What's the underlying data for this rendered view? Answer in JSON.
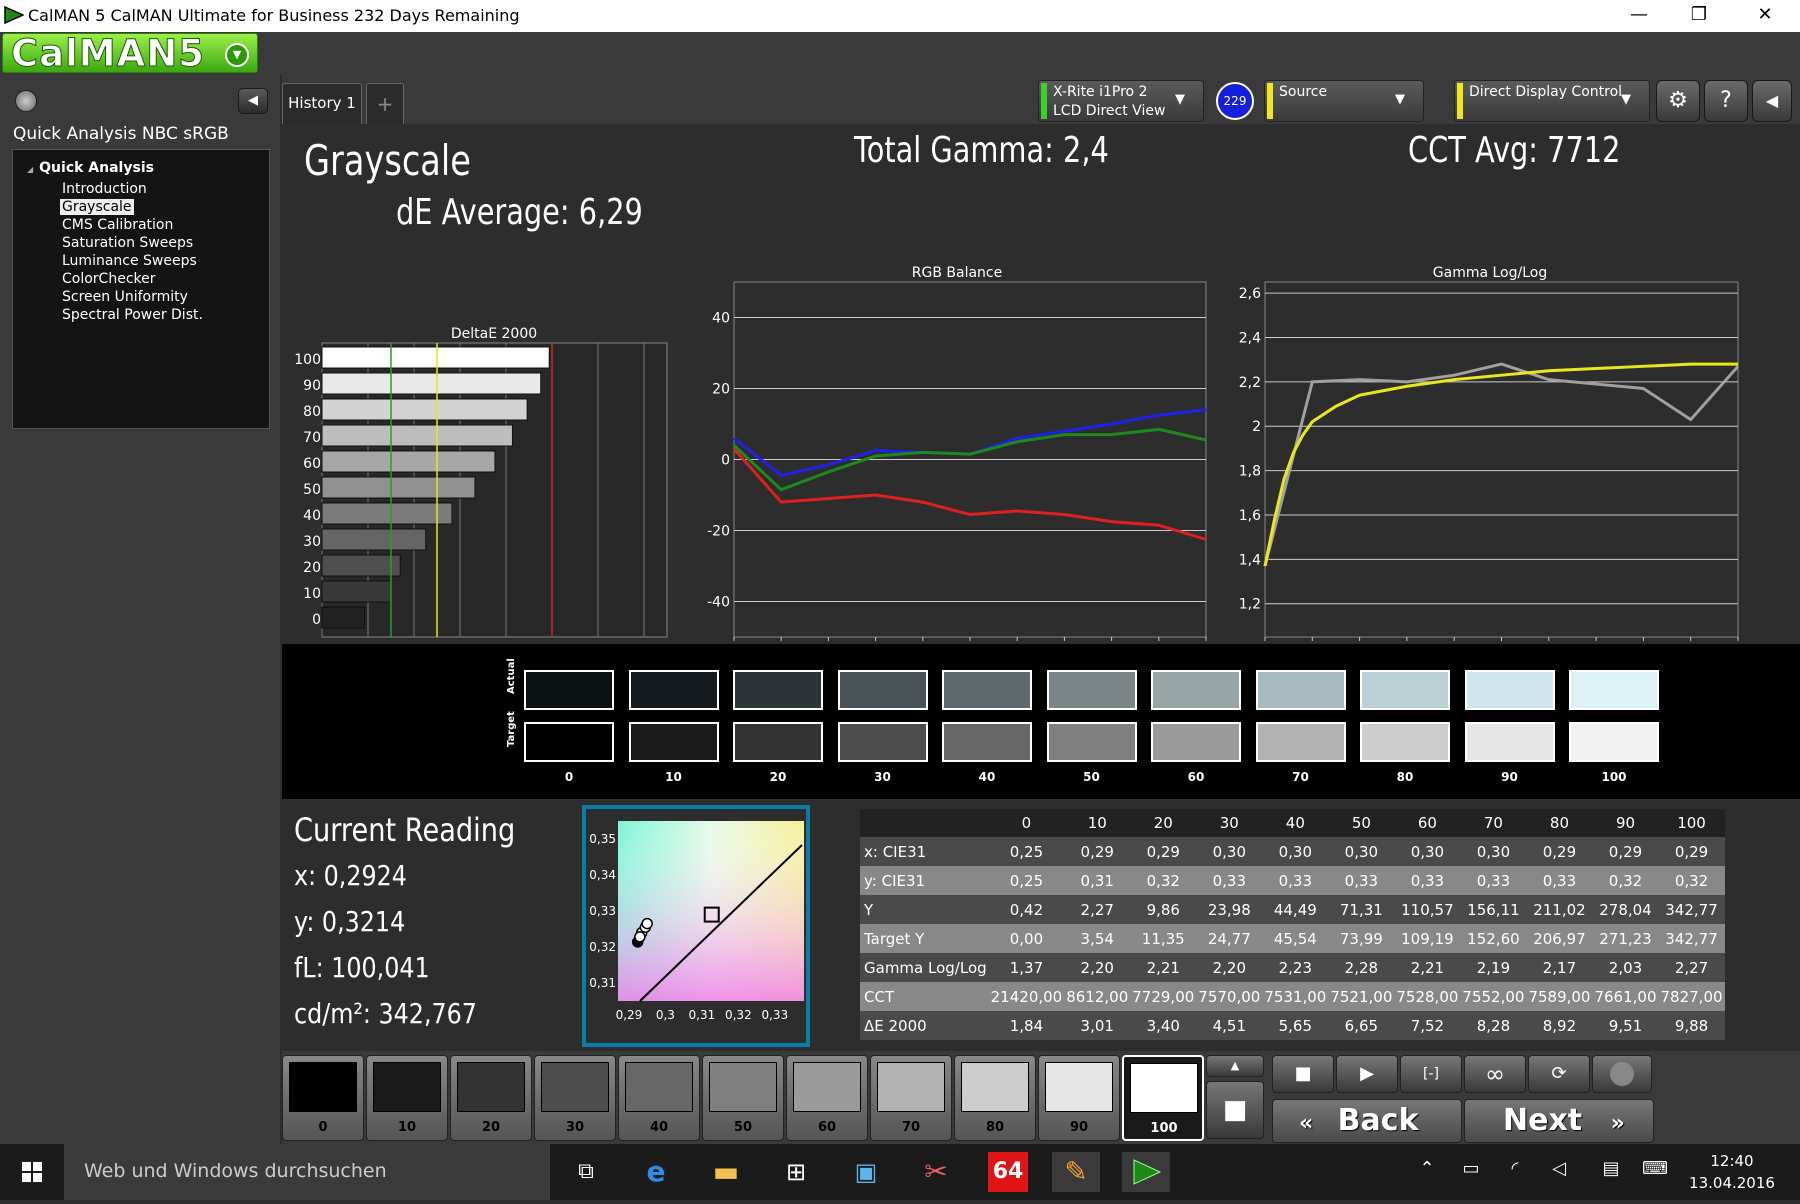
{
  "window": {
    "title": "CalMAN 5 CalMAN Ultimate for Business 232 Days Remaining",
    "min": "—",
    "restore": "❐",
    "close": "✕"
  },
  "logo": {
    "text": "CalMAN5",
    "dropdown": "▼"
  },
  "sidebar": {
    "collapse": "◀",
    "workflow_title": "Quick Analysis NBC sRGB",
    "group_label": "Quick Analysis",
    "items": [
      {
        "label": "Introduction"
      },
      {
        "label": "Grayscale"
      },
      {
        "label": "CMS Calibration"
      },
      {
        "label": "Saturation Sweeps"
      },
      {
        "label": "Luminance Sweeps"
      },
      {
        "label": "ColorChecker"
      },
      {
        "label": "Screen Uniformity"
      },
      {
        "label": "Spectral Power Dist."
      }
    ],
    "selected_index": 1
  },
  "tabs": {
    "history": "History 1",
    "add": "+"
  },
  "devices": {
    "meter": {
      "line1": "X-Rite i1Pro 2",
      "line2": "LCD Direct View",
      "color": "#39d12a"
    },
    "meter_badge": "229",
    "source": {
      "line1": "Source",
      "color": "#f0e61e"
    },
    "display": {
      "line1": "Direct Display Control",
      "color": "#f0e61e"
    },
    "dropdown": "▼",
    "settings": "⚙",
    "help": "?",
    "collapse": "◀"
  },
  "page": {
    "title": "Grayscale",
    "de_average": "dE Average: 6,29",
    "total_gamma": "Total Gamma: 2,4",
    "cct_avg": "CCT Avg: 7712"
  },
  "chart_data": [
    {
      "type": "bar",
      "title": "DeltaE 2000",
      "orientation": "horizontal",
      "categories": [
        "100",
        "90",
        "80",
        "70",
        "60",
        "50",
        "40",
        "30",
        "20",
        "10",
        "0"
      ],
      "values": [
        9.88,
        9.51,
        8.92,
        8.28,
        7.52,
        6.65,
        5.65,
        4.51,
        3.4,
        3.01,
        1.84
      ],
      "xlim": [
        0,
        15
      ],
      "xticks": [
        "0",
        "2",
        "4",
        "6",
        "8",
        "10",
        "12",
        "14"
      ],
      "thresholds": [
        {
          "value": 3,
          "color": "#2a9d2a"
        },
        {
          "value": 5,
          "color": "#e6e61e"
        },
        {
          "value": 10,
          "color": "#d42020"
        }
      ]
    },
    {
      "type": "line",
      "title": "RGB Balance",
      "x": [
        0,
        10,
        20,
        30,
        40,
        50,
        60,
        70,
        80,
        90,
        100
      ],
      "xticks": [
        "0",
        "10",
        "20",
        "30",
        "40",
        "50",
        "60",
        "70",
        "80",
        "90",
        "100"
      ],
      "ylim": [
        -50,
        50
      ],
      "yticks": [
        "40",
        "20",
        "0",
        "-20",
        "-40"
      ],
      "series": [
        {
          "color": "#e02020",
          "values": [
            3,
            -12,
            -11,
            -10,
            -12,
            -15.5,
            -14.5,
            -15.5,
            -17.5,
            -18.5,
            -22.5
          ]
        },
        {
          "color": "#2020e8",
          "values": [
            6,
            -4.5,
            -1.5,
            2.5,
            2,
            1.5,
            6,
            8,
            10,
            12.5,
            14
          ]
        },
        {
          "color": "#1e8a1e",
          "values": [
            4,
            -8.5,
            -3.5,
            1,
            2,
            1.5,
            5,
            7,
            7,
            8.5,
            5.5
          ]
        }
      ]
    },
    {
      "type": "line",
      "title": "Gamma Log/Log",
      "x": [
        0,
        10,
        20,
        30,
        40,
        50,
        60,
        70,
        80,
        90,
        100
      ],
      "xticks": [
        "0",
        "10",
        "20",
        "30",
        "40",
        "50",
        "60",
        "70",
        "80",
        "90",
        "100"
      ],
      "ylim": [
        1.05,
        2.65
      ],
      "yticks": [
        "2,6",
        "2,4",
        "2,2",
        "2",
        "1,8",
        "1,6",
        "1,4",
        "1,2"
      ],
      "series": [
        {
          "color": "#a0a0a0",
          "values": [
            1.37,
            2.2,
            2.21,
            2.2,
            2.23,
            2.28,
            2.21,
            2.19,
            2.17,
            2.03,
            2.27
          ]
        },
        {
          "color": "#e8e81e",
          "curve": [
            [
              0,
              1.37
            ],
            [
              2,
              1.58
            ],
            [
              4,
              1.76
            ],
            [
              6,
              1.88
            ],
            [
              8,
              1.96
            ],
            [
              10,
              2.02
            ],
            [
              15,
              2.09
            ],
            [
              20,
              2.14
            ],
            [
              30,
              2.18
            ],
            [
              40,
              2.21
            ],
            [
              50,
              2.23
            ],
            [
              60,
              2.25
            ],
            [
              70,
              2.26
            ],
            [
              80,
              2.27
            ],
            [
              90,
              2.28
            ],
            [
              100,
              2.28
            ]
          ]
        }
      ]
    },
    {
      "type": "scatter",
      "title": "CIE xy",
      "xticks": [
        "0,29",
        "0,3",
        "0,31",
        "0,32",
        "0,33"
      ],
      "yticks": [
        "0,35",
        "0,34",
        "0,33",
        "0,32",
        "0,31"
      ],
      "xlim": [
        0.287,
        0.338
      ],
      "ylim": [
        0.305,
        0.355
      ],
      "target": {
        "x": 0.3127,
        "y": 0.329
      },
      "points": [
        [
          0.2924,
          0.3214
        ],
        [
          0.2935,
          0.324
        ],
        [
          0.2945,
          0.3255
        ],
        [
          0.295,
          0.3265
        ],
        [
          0.293,
          0.3228
        ]
      ]
    }
  ],
  "swatches": {
    "actual_label": "Actual",
    "target_label": "Target",
    "levels": [
      "0",
      "10",
      "20",
      "30",
      "40",
      "50",
      "60",
      "70",
      "80",
      "90",
      "100"
    ],
    "actual_colors": [
      "#0c1114",
      "#141a1d",
      "#2c3437",
      "#4a5357",
      "#5f686c",
      "#7b8588",
      "#98a5a7",
      "#aabbbf",
      "#bcd1d5",
      "#d0e6ec",
      "#dcf2f7"
    ],
    "target_colors": [
      "#000000",
      "#1a1a1a",
      "#333333",
      "#4d4d4d",
      "#676767",
      "#808080",
      "#9a9a9a",
      "#b3b3b3",
      "#cdcdcd",
      "#e6e6e6",
      "#f2f2f2"
    ]
  },
  "current_reading": {
    "title": "Current Reading",
    "x": "x: 0,2924",
    "y": "y: 0,3214",
    "fl": "fL: 100,041",
    "cdm2": "cd/m²: 342,767"
  },
  "table": {
    "columns": [
      "",
      "0",
      "10",
      "20",
      "30",
      "40",
      "50",
      "60",
      "70",
      "80",
      "90",
      "100"
    ],
    "rows": [
      {
        "label": "x: CIE31",
        "values": [
          "0,25",
          "0,29",
          "0,29",
          "0,30",
          "0,30",
          "0,30",
          "0,30",
          "0,30",
          "0,29",
          "0,29",
          "0,29"
        ]
      },
      {
        "label": "y: CIE31",
        "values": [
          "0,25",
          "0,31",
          "0,32",
          "0,33",
          "0,33",
          "0,33",
          "0,33",
          "0,33",
          "0,33",
          "0,32",
          "0,32"
        ]
      },
      {
        "label": "Y",
        "values": [
          "0,42",
          "2,27",
          "9,86",
          "23,98",
          "44,49",
          "71,31",
          "110,57",
          "156,11",
          "211,02",
          "278,04",
          "342,77"
        ]
      },
      {
        "label": "Target Y",
        "values": [
          "0,00",
          "3,54",
          "11,35",
          "24,77",
          "45,54",
          "73,99",
          "109,19",
          "152,60",
          "206,97",
          "271,23",
          "342,77"
        ]
      },
      {
        "label": "Gamma Log/Log",
        "values": [
          "1,37",
          "2,20",
          "2,21",
          "2,20",
          "2,23",
          "2,28",
          "2,21",
          "2,19",
          "2,17",
          "2,03",
          "2,27"
        ]
      },
      {
        "label": "CCT",
        "values": [
          "21420,00",
          "8612,00",
          "7729,00",
          "7570,00",
          "7531,00",
          "7521,00",
          "7528,00",
          "7552,00",
          "7589,00",
          "7661,00",
          "7827,00"
        ]
      },
      {
        "label": "ΔE 2000",
        "values": [
          "1,84",
          "3,01",
          "3,40",
          "4,51",
          "5,65",
          "6,65",
          "7,52",
          "8,28",
          "8,92",
          "9,51",
          "9,88"
        ]
      }
    ]
  },
  "patches": {
    "labels": [
      "0",
      "10",
      "20",
      "30",
      "40",
      "50",
      "60",
      "70",
      "80",
      "90",
      "100"
    ],
    "colors": [
      "#000000",
      "#1a1a1a",
      "#333333",
      "#4d4d4d",
      "#676767",
      "#808080",
      "#9a9a9a",
      "#b3b3b3",
      "#cdcdcd",
      "#e6e6e6",
      "#ffffff"
    ],
    "active_index": 10
  },
  "controls": {
    "stop": "■",
    "play": "▶",
    "frame": "[‑]",
    "loop": "∞",
    "refresh": "⟳",
    "toggle": "",
    "back": "Back",
    "next": "Next",
    "up": "▲",
    "record": "■"
  },
  "taskbar": {
    "search_placeholder": "Web und Windows durchsuchen",
    "badge64": "64",
    "time": "12:40",
    "date": "13.04.2016"
  }
}
